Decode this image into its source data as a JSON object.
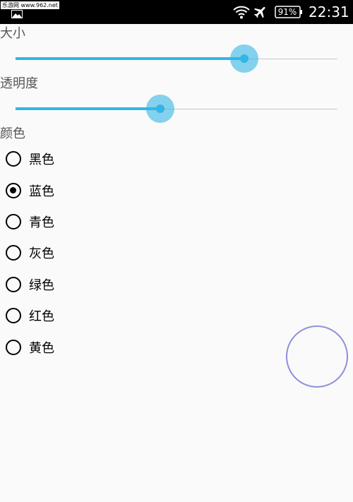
{
  "status_bar": {
    "watermark": "乐游网 www.962.net",
    "battery": "91%",
    "time": "22:31",
    "icons": [
      "image-icon",
      "wifi-icon",
      "airplane-icon",
      "battery-icon"
    ]
  },
  "size": {
    "label": "大小",
    "value_fraction": 0.71
  },
  "opacity": {
    "label": "透明度",
    "value_fraction": 0.45
  },
  "color": {
    "label": "颜色",
    "options": [
      "黑色",
      "蓝色",
      "青色",
      "灰色",
      "绿色",
      "红色",
      "黄色"
    ],
    "selected": "蓝色"
  },
  "preview": {
    "stroke_color": "#8e8edc"
  },
  "accent_color": "#33b5e5"
}
